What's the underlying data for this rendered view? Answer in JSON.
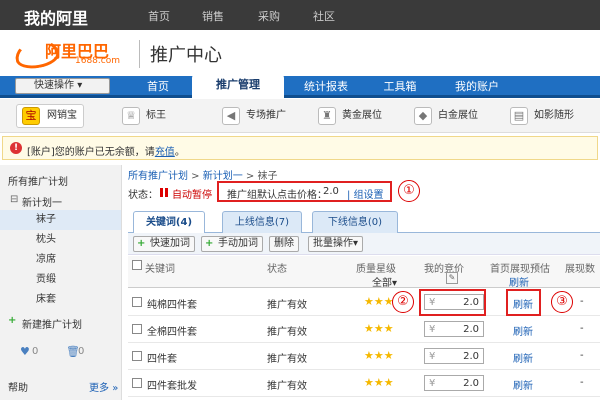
{
  "topnav": {
    "logo": "我的阿里",
    "items": [
      "首页",
      "销售",
      "采购",
      "社区"
    ]
  },
  "brand": {
    "name": "阿里巴巴",
    "domain": "1688.com",
    "page_title": "推广中心"
  },
  "navbar": {
    "quick_ops": "快速操作",
    "tabs": [
      "首页",
      "推广管理",
      "统计报表",
      "工具箱",
      "我的账户"
    ],
    "active_tab": "推广管理"
  },
  "subnav": {
    "items": [
      "网销宝",
      "标王",
      "专场推广",
      "黄金展位",
      "白金展位",
      "如影随形"
    ],
    "selected": "网销宝"
  },
  "alert": {
    "text": "[账户]您的账户已无余额，请",
    "link": "充值",
    "suffix": "。"
  },
  "sidebar": {
    "all_plans": "所有推广计划",
    "plan": "新计划一",
    "children": [
      "袜子",
      "枕头",
      "凉席",
      "贡缎",
      "床套"
    ],
    "selected": "袜子",
    "new_plan": "新建推广计划",
    "heart_count": "0",
    "trash_count": "0",
    "help": "帮助",
    "more": "更多"
  },
  "breadcrumb": {
    "root": "所有推广计划",
    "plan": "新计划一",
    "current": "袜子"
  },
  "status": {
    "label": "状态：",
    "value": "自动暂停"
  },
  "default_price": {
    "label": "推广组默认点击价格：",
    "value": "2.0",
    "action": "组设置"
  },
  "annotations": [
    "①",
    "②",
    "③"
  ],
  "keyword_tabs": [
    {
      "label": "关键词(4)"
    },
    {
      "label": "上线信息(7)"
    },
    {
      "label": "下线信息(0)"
    }
  ],
  "toolbar": {
    "quick_add": "快速加词",
    "manual_add": "手动加词",
    "delete": "删除",
    "batch": "批量操作"
  },
  "table": {
    "columns": {
      "keyword": "关键词",
      "status": "状态",
      "quality": "质量星级",
      "quality_filter": "全部",
      "bid": "我的竞价",
      "estimate": "首页展现预估",
      "estimate_refresh": "刷新",
      "impressions": "展现数"
    },
    "rows": [
      {
        "keyword": "纯棉四件套",
        "status": "推广有效",
        "stars": "★★★",
        "bid_currency": "¥",
        "bid": "2.0",
        "estimate": "刷新",
        "impr": "-"
      },
      {
        "keyword": "全棉四件套",
        "status": "推广有效",
        "stars": "★★★",
        "bid_currency": "¥",
        "bid": "2.0",
        "estimate": "刷新",
        "impr": "-"
      },
      {
        "keyword": "四件套",
        "status": "推广有效",
        "stars": "★★★",
        "bid_currency": "¥",
        "bid": "2.0",
        "estimate": "刷新",
        "impr": "-"
      },
      {
        "keyword": "四件套批发",
        "status": "推广有效",
        "stars": "★★★",
        "bid_currency": "¥",
        "bid": "2.0",
        "estimate": "刷新",
        "impr": "-"
      }
    ]
  },
  "colors": {
    "nav_blue": "#1f6fc2",
    "brand_orange": "#ff6600",
    "highlight_red": "#e02020",
    "link_blue": "#1a5fb4"
  }
}
